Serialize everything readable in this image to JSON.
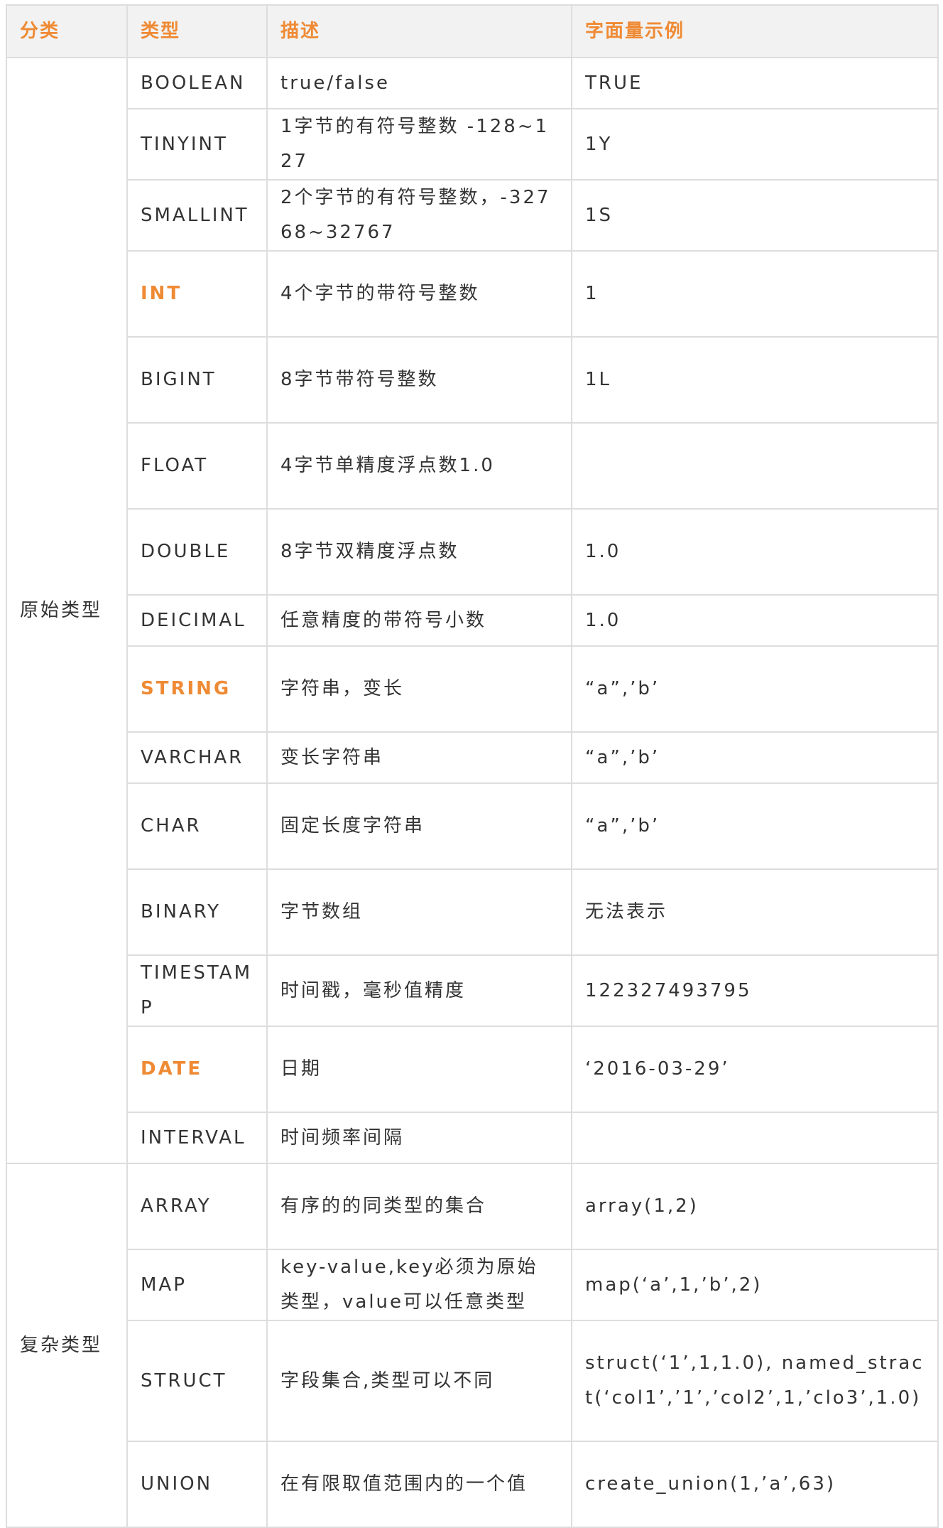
{
  "headers": [
    "分类",
    "类型",
    "描述",
    "字面量示例"
  ],
  "groups": [
    {
      "category": "原始类型",
      "rows": [
        {
          "type": "BOOLEAN",
          "desc": "true/false",
          "example": "TRUE",
          "highlight": false,
          "lines": 2
        },
        {
          "type": "TINYINT",
          "desc": "1字节的有符号整数 -128~127",
          "example": "1Y",
          "highlight": false,
          "lines": 2
        },
        {
          "type": "SMALLINT",
          "desc": "2个字节的有符号整数，-32768~32767",
          "example": "1S",
          "highlight": false,
          "lines": 2
        },
        {
          "type": "INT",
          "desc": "4个字节的带符号整数",
          "example": "1",
          "highlight": true,
          "lines": 1
        },
        {
          "type": "BIGINT",
          "desc": "8字节带符号整数",
          "example": "1L",
          "highlight": false,
          "lines": 1
        },
        {
          "type": "FLOAT",
          "desc": "4字节单精度浮点数1.0",
          "example": "",
          "highlight": false,
          "lines": 1
        },
        {
          "type": "DOUBLE",
          "desc": "8字节双精度浮点数",
          "example": "1.0",
          "highlight": false,
          "lines": 1
        },
        {
          "type": "DEICIMAL",
          "desc": "任意精度的带符号小数",
          "example": "1.0",
          "highlight": false,
          "lines": 2
        },
        {
          "type": "STRING",
          "desc": "字符串，变长",
          "example": "“a”,’b’",
          "highlight": true,
          "lines": 1
        },
        {
          "type": "VARCHAR",
          "desc": "变长字符串",
          "example": "“a”,’b’",
          "highlight": false,
          "lines": 2
        },
        {
          "type": "CHAR",
          "desc": "固定长度字符串",
          "example": "“a”,’b’",
          "highlight": false,
          "lines": 1
        },
        {
          "type": "BINARY",
          "desc": "字节数组",
          "example": "无法表示",
          "highlight": false,
          "lines": 1
        },
        {
          "type": "TIMESTAMP",
          "desc": "时间戳，毫秒值精度",
          "example": "122327493795",
          "highlight": false,
          "lines": 2
        },
        {
          "type": "DATE",
          "desc": "日期",
          "example": "‘2016-03-29’",
          "highlight": true,
          "lines": 1
        },
        {
          "type": "INTERVAL",
          "desc": "时间频率间隔",
          "example": "",
          "highlight": false,
          "lines": 2
        }
      ]
    },
    {
      "category": "复杂类型",
      "rows": [
        {
          "type": "ARRAY",
          "desc": "有序的的同类型的集合",
          "example": "array(1,2)",
          "highlight": false,
          "lines": 1
        },
        {
          "type": "MAP",
          "desc": "key-value,key必须为原始类型，value可以任意类型",
          "example": "map(‘a’,1,’b’,2)",
          "highlight": false,
          "lines": 2
        },
        {
          "type": "STRUCT",
          "desc": "字段集合,类型可以不同",
          "example": "struct(‘1’,1,1.0), named_stract(‘col1’,’1’,’col2’,1,’clo3’,1.0)",
          "highlight": false,
          "lines": 3
        },
        {
          "type": "UNION",
          "desc": "在有限取值范围内的一个值",
          "example": "create_union(1,’a’,63)",
          "highlight": false,
          "lines": 1
        }
      ]
    }
  ]
}
